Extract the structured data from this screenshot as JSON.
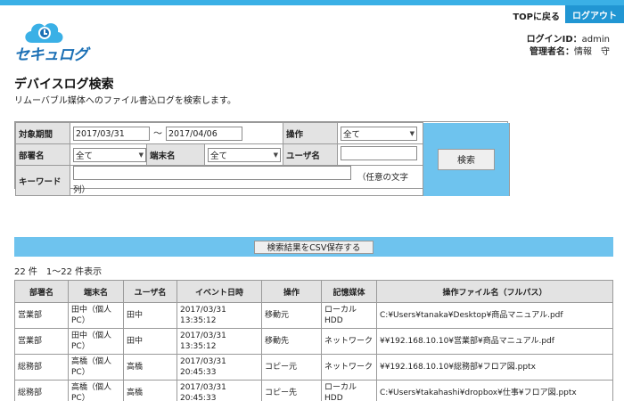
{
  "header": {
    "logo_text": "セキュログ",
    "top_link": "TOPに戻る",
    "logout": "ログアウト",
    "login_id_label": "ログインID：",
    "login_id_value": "admin",
    "manager_label": "管理者名：",
    "manager_value": "情報　守"
  },
  "page": {
    "title": "デバイスログ検索",
    "description": "リムーバブル媒体へのファイル書込ログを検索します。"
  },
  "search": {
    "period_label": "対象期間",
    "period_from": "2017/03/31",
    "period_separator": "～",
    "period_to": "2017/04/06",
    "operation_label": "操作",
    "operation_value": "全て",
    "department_label": "部署名",
    "department_value": "全て",
    "terminal_label": "端末名",
    "terminal_value": "全て",
    "user_label": "ユーザ名",
    "user_value": "",
    "keyword_label": "キーワード",
    "keyword_value": "",
    "keyword_hint": "（任意の文字列）",
    "search_button": "検索"
  },
  "csv_button": "検索結果をCSV保存する",
  "result_count": "22 件　1～22 件表示",
  "table": {
    "columns": [
      "部署名",
      "端末名",
      "ユーザ名",
      "イベント日時",
      "操作",
      "記憶媒体",
      "操作ファイル名（フルパス）"
    ],
    "rows": [
      [
        "営業部",
        "田中（個人PC）",
        "田中",
        "2017/03/31 13:35:12",
        "移動元",
        "ローカルHDD",
        "C:¥Users¥tanaka¥Desktop¥商品マニュアル.pdf"
      ],
      [
        "営業部",
        "田中（個人PC）",
        "田中",
        "2017/03/31 13:35:12",
        "移動先",
        "ネットワーク",
        "¥¥192.168.10.10¥営業部¥商品マニュアル.pdf"
      ],
      [
        "総務部",
        "高橋（個人PC）",
        "高橋",
        "2017/03/31 20:45:33",
        "コピー元",
        "ネットワーク",
        "¥¥192.168.10.10¥総務部¥フロア図.pptx"
      ],
      [
        "総務部",
        "高橋（個人PC）",
        "高橋",
        "2017/03/31 20:45:33",
        "コピー先",
        "ローカルHDD",
        "C:¥Users¥takahashi¥dropbox¥仕事¥フロア図.pptx"
      ]
    ]
  },
  "colors": {
    "accent": "#3ab0e6",
    "panel_blue": "#6ec3ee",
    "logout_bg": "#2196d3",
    "label_bg": "#e3e3e3"
  }
}
